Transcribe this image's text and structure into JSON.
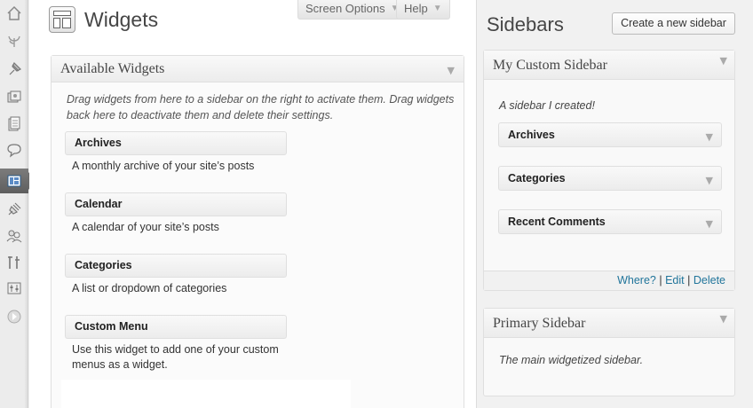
{
  "admin_menu": {
    "icons": [
      "dashboard-icon",
      "jetpack-icon",
      "posts-icon",
      "media-icon",
      "pages-icon",
      "comments-icon",
      "appearance-icon",
      "plugins-icon",
      "users-icon",
      "tools-icon",
      "settings-icon",
      "collapse-icon"
    ],
    "current": "appearance-icon"
  },
  "header": {
    "title": "Widgets",
    "screen_options_label": "Screen Options",
    "help_label": "Help"
  },
  "available_widgets": {
    "title": "Available Widgets",
    "description": "Drag widgets from here to a sidebar on the right to activate them. Drag widgets back here to deactivate them and delete their settings.",
    "widgets": [
      {
        "name": "Archives",
        "description": "A monthly archive of your site’s posts"
      },
      {
        "name": "Calendar",
        "description": "A calendar of your site’s posts"
      },
      {
        "name": "Categories",
        "description": "A list or dropdown of categories"
      },
      {
        "name": "Custom Menu",
        "description": "Use this widget to add one of your custom menus as a widget."
      }
    ]
  },
  "sidebars": {
    "title": "Sidebars",
    "create_button": "Create a new sidebar",
    "custom": {
      "title": "My Custom Sidebar",
      "description": "A sidebar I created!",
      "widgets": [
        "Archives",
        "Categories",
        "Recent Comments"
      ],
      "links": {
        "where": "Where?",
        "edit": "Edit",
        "delete": "Delete",
        "separator": "|"
      }
    },
    "primary": {
      "title": "Primary Sidebar",
      "description": "The main widgetized sidebar."
    }
  },
  "colors": {
    "link": "#21759b",
    "menu_current": "#6a6a6a"
  }
}
